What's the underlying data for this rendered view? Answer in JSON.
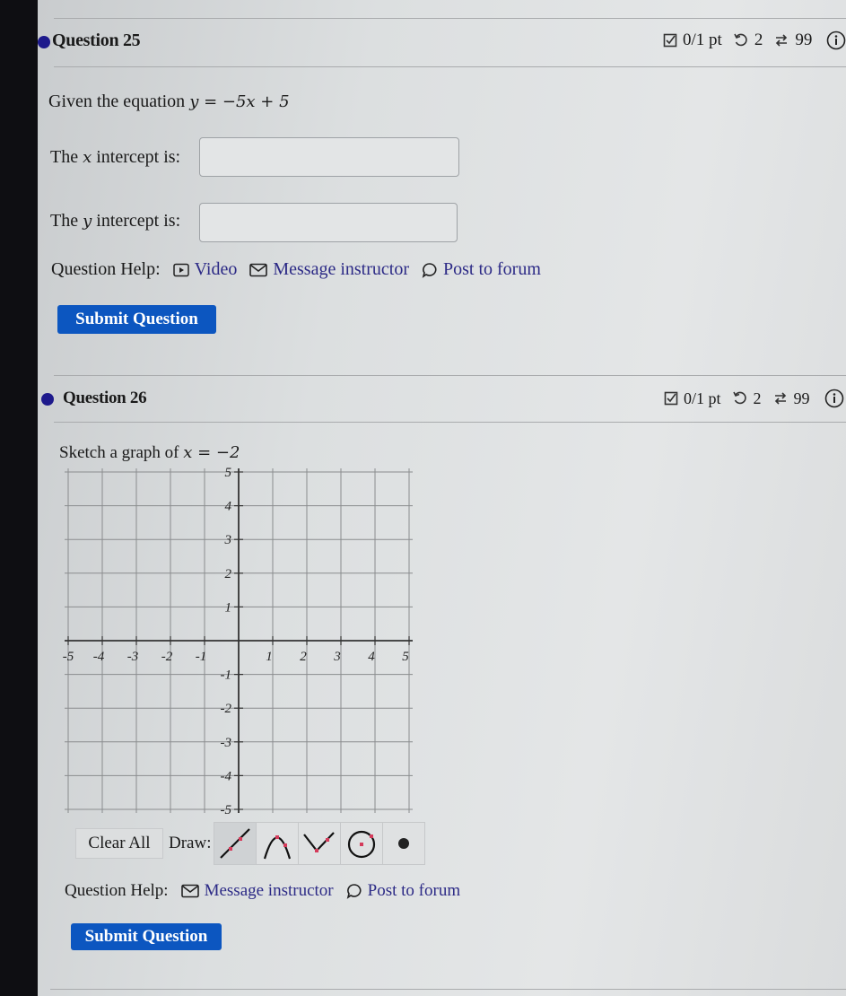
{
  "questions": [
    {
      "title": "Question 25",
      "score": "0/1 pt",
      "retries": "2",
      "attempts": "99",
      "prompt_prefix": "Given the equation ",
      "equation": "y = −5x + 5",
      "fields": [
        {
          "label_prefix": "The ",
          "var": "x",
          "label_suffix": " intercept is:",
          "value": "",
          "placeholder": ""
        },
        {
          "label_prefix": "The ",
          "var": "y",
          "label_suffix": " intercept is:",
          "value": "",
          "placeholder": ""
        }
      ],
      "help": {
        "label": "Question Help:",
        "links": [
          {
            "icon": "video-icon",
            "label": "Video"
          },
          {
            "icon": "mail-icon",
            "label": "Message instructor"
          },
          {
            "icon": "forum-icon",
            "label": "Post to forum"
          }
        ]
      },
      "submit_label": "Submit Question"
    },
    {
      "title": "Question 26",
      "score": "0/1 pt",
      "retries": "2",
      "attempts": "99",
      "trailing_cut_text": "I",
      "prompt_prefix": "Sketch a graph of ",
      "equation": "x = −2",
      "graph": {
        "x_range": [
          -5,
          5
        ],
        "y_range": [
          -5,
          5
        ],
        "x_ticks": [
          "-5",
          "-4",
          "-3",
          "-2",
          "-1",
          "1",
          "2",
          "3",
          "4",
          "5"
        ],
        "y_ticks": [
          "5",
          "4",
          "3",
          "2",
          "1",
          "-1",
          "-2",
          "-3",
          "-4",
          "-5"
        ]
      },
      "toolbar": {
        "clear_label": "Clear All",
        "draw_label": "Draw:",
        "tools": [
          "line-tool",
          "parabola-tool",
          "absolute-value-tool",
          "circle-tool",
          "point-tool"
        ]
      },
      "help": {
        "label": "Question Help:",
        "links": [
          {
            "icon": "mail-icon",
            "label": "Message instructor"
          },
          {
            "icon": "forum-icon",
            "label": "Post to forum"
          }
        ]
      },
      "submit_label": "Submit Question"
    }
  ],
  "colors": {
    "accent": "#0c56c0",
    "link": "#2c2a86",
    "question_dot": "#1e1a8c",
    "tool_point": "#d43a5a"
  }
}
